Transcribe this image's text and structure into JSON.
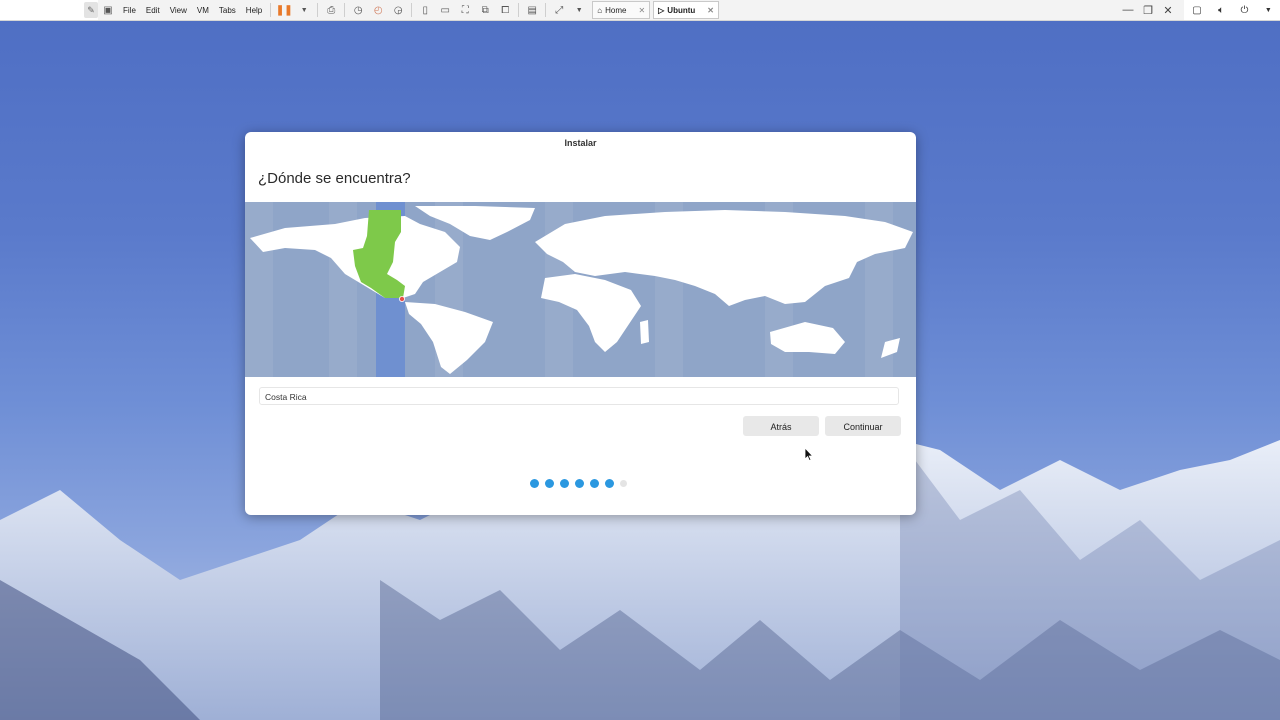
{
  "toolbar": {
    "menu": [
      "File",
      "Edit",
      "View",
      "VM",
      "Tabs",
      "Help"
    ],
    "tabs": [
      {
        "label": "Home",
        "active": false
      },
      {
        "label": "Ubuntu",
        "active": true
      }
    ]
  },
  "dialog": {
    "title": "Instalar",
    "heading": "¿Dónde se encuentra?",
    "timezone_value": "Costa Rica",
    "back_label": "Atrás",
    "continue_label": "Continuar",
    "progress": {
      "total_steps": 7,
      "completed_steps": 6
    }
  },
  "colors": {
    "accent": "#2b98e0",
    "selected_zone": "#7ec94a",
    "map_ocean": "#8fa5c8",
    "selected_band": "#6f90d0"
  }
}
